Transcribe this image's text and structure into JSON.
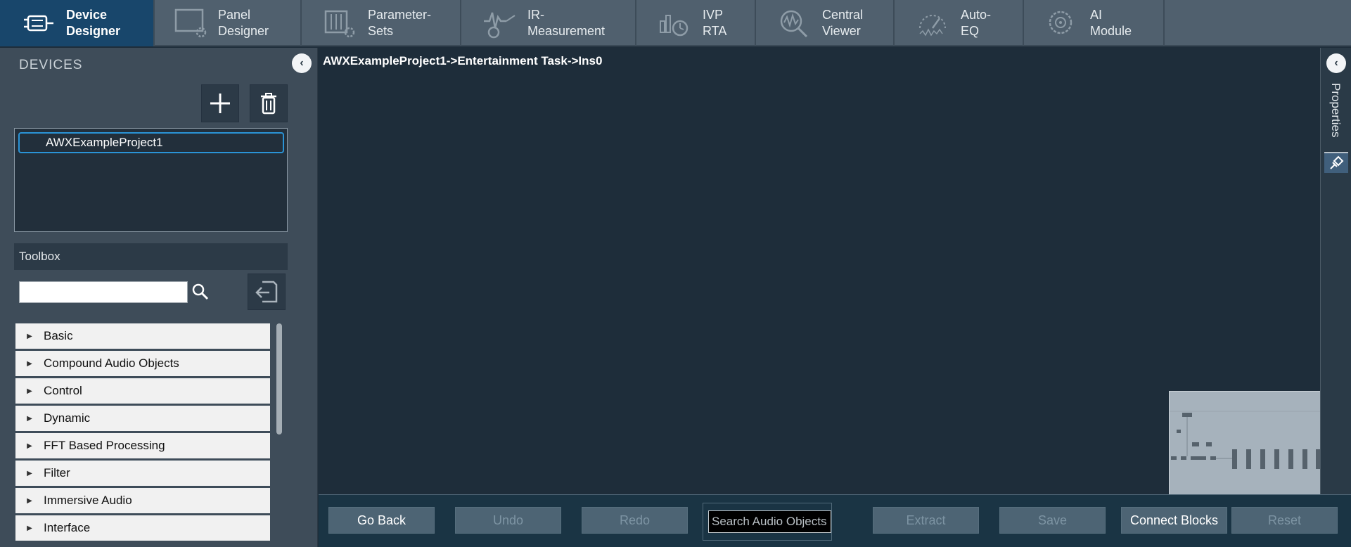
{
  "tabs": [
    {
      "line1": "Device",
      "line2": "Designer",
      "icon": "device-designer-icon",
      "active": true
    },
    {
      "line1": "Panel",
      "line2": "Designer",
      "icon": "panel-designer-icon"
    },
    {
      "line1": "Parameter-",
      "line2": "Sets",
      "icon": "parameter-sets-icon"
    },
    {
      "line1": "IR-",
      "line2": "Measurement",
      "icon": "ir-measurement-icon"
    },
    {
      "line1": "IVP",
      "line2": "RTA",
      "icon": "ivp-rta-icon"
    },
    {
      "line1": "Central",
      "line2": "Viewer",
      "icon": "central-viewer-icon"
    },
    {
      "line1": "Auto-",
      "line2": "EQ",
      "icon": "auto-eq-icon"
    },
    {
      "line1": "AI",
      "line2": "Module",
      "icon": "ai-module-icon"
    }
  ],
  "devices": {
    "title": "DEVICES",
    "items": [
      "AWXExampleProject1"
    ]
  },
  "toolbox": {
    "title": "Toolbox",
    "search_value": "",
    "categories": [
      "Basic",
      "Compound Audio Objects",
      "Control",
      "Dynamic",
      "FFT Based Processing",
      "Filter",
      "Immersive Audio",
      "Interface"
    ]
  },
  "canvas": {
    "breadcrumb": "AWXExampleProject1->Entertainment Task->Ins0"
  },
  "properties": {
    "label": "Properties"
  },
  "bottom_bar": {
    "go_back": "Go Back",
    "undo": "Undo",
    "redo": "Redo",
    "search_placeholder": "Search Audio Objects",
    "extract": "Extract",
    "save": "Save",
    "connect_blocks": "Connect Blocks",
    "reset": "Reset"
  },
  "colors": {
    "accent": "#18466b",
    "selection": "#2a93d6",
    "canvas_bg": "#1e2d3a"
  }
}
